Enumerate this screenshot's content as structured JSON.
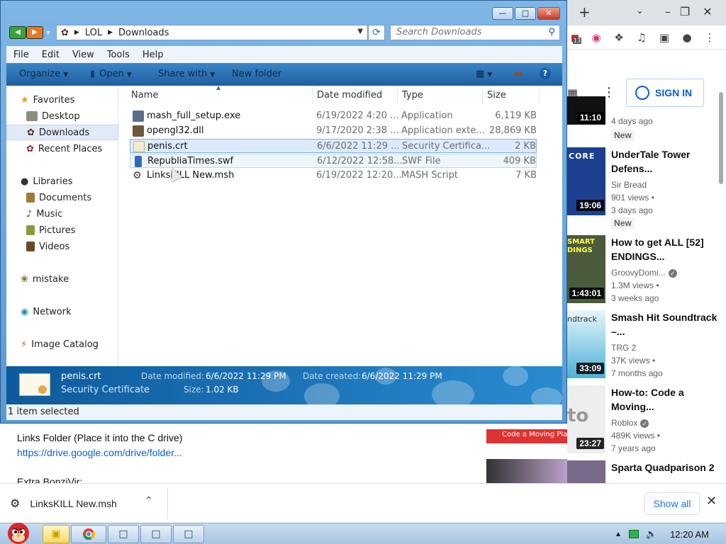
{
  "explorer": {
    "breadcrumb": [
      "LOL",
      "Downloads"
    ],
    "search_placeholder": "Search Downloads",
    "menu": [
      "File",
      "Edit",
      "View",
      "Tools",
      "Help"
    ],
    "commands": {
      "organize": "Organize",
      "open": "Open",
      "share": "Share with",
      "new_folder": "New folder"
    },
    "nav": {
      "favorites": "Favorites",
      "desktop": "Desktop",
      "downloads": "Downloads",
      "recent": "Recent Places",
      "libraries": "Libraries",
      "documents": "Documents",
      "music": "Music",
      "pictures": "Pictures",
      "videos": "Videos",
      "mistake": "mistake",
      "network": "Network",
      "image_catalog": "Image Catalog"
    },
    "columns": {
      "name": "Name",
      "date": "Date modified",
      "type": "Type",
      "size": "Size"
    },
    "files": [
      {
        "name": "mash_full_setup.exe",
        "date": "6/19/2022 4:20 ...",
        "type": "Application",
        "size": "6,119 KB",
        "icon": "exe-icon",
        "color": "#5b6f8a"
      },
      {
        "name": "opengl32.dll",
        "date": "9/17/2020 2:38 ...",
        "type": "Application exte...",
        "size": "28,869 KB",
        "icon": "dll-icon",
        "color": "#6b5a3a"
      },
      {
        "name": "penis.crt",
        "date": "6/6/2022 11:29 ...",
        "type": "Security Certifica...",
        "size": "2 KB",
        "icon": "certificate-icon",
        "color": "#d9c77a"
      },
      {
        "name": "RepubliaTimes.swf",
        "date": "6/12/2022 12:58...",
        "type": "SWF File",
        "size": "409 KB",
        "icon": "swf-icon",
        "color": "#2e6db3"
      },
      {
        "name": "LinksKILL New.msh",
        "date": "6/19/2022 12:20...",
        "type": "MASH Script",
        "size": "7 KB",
        "icon": "mash-script-icon",
        "color": "#333333"
      }
    ],
    "details": {
      "name": "penis.crt",
      "type": "Security Certificate",
      "modified_label": "Date modified:",
      "modified": "6/6/2022 11:29 PM",
      "created_label": "Date created:",
      "created": "6/6/2022 11:29 PM",
      "size_label": "Size:",
      "size": "1.02 KB"
    },
    "status": "1 item selected"
  },
  "browser": {
    "badge_count": "13",
    "sign_in": "SIGN IN",
    "videos": [
      {
        "duration": "11:10",
        "title": "",
        "channel": "",
        "views": "",
        "age": "4 days ago",
        "new": "New",
        "thumb": "#3a3a3a"
      },
      {
        "duration": "19:06",
        "title": "UnderTale Tower Defens...",
        "channel": "Sir Bread",
        "views": "901 views •",
        "age": "3 days ago",
        "new": "New",
        "thumb": "#1d3f8f"
      },
      {
        "duration": "1:43:01",
        "title": "How to get ALL [52] ENDINGS...",
        "channel": "GroovyDomi...",
        "views": "1.3M views •",
        "age": "3 weeks ago",
        "new": "",
        "thumb": "#4a5a3a"
      },
      {
        "duration": "33:09",
        "title": "Smash Hit Soundtrack –...",
        "channel": "TRG 2",
        "views": "37K views •",
        "age": "7 months ago",
        "new": "",
        "thumb": "#5fb7d8"
      },
      {
        "duration": "23:27",
        "title": "How-to: Code a Moving...",
        "channel": "Roblox",
        "views": "489K views •",
        "age": "7 years ago",
        "new": "",
        "thumb": "#e8e8e8"
      },
      {
        "duration": "",
        "title": "Sparta Quadparison 2",
        "channel": "",
        "views": "",
        "age": "",
        "new": "",
        "thumb": "#7a6a8a"
      }
    ],
    "thumb_text": {
      "t2a": "CORE",
      "t3a": "SMART",
      "t3b": "DINGS",
      "t4a": "ndtrack",
      "t5a": "to",
      "left_banner": "Code a Moving Platform"
    },
    "description": {
      "line1": "Links Folder (Place it into the C drive)",
      "link": "https://drive.google.com/drive/folder...",
      "line3": "Extra BonziVir:"
    }
  },
  "download_bar": {
    "file": "LinksKILL New.msh",
    "show_all": "Show all"
  },
  "taskbar": {
    "time": "12:20 AM"
  }
}
